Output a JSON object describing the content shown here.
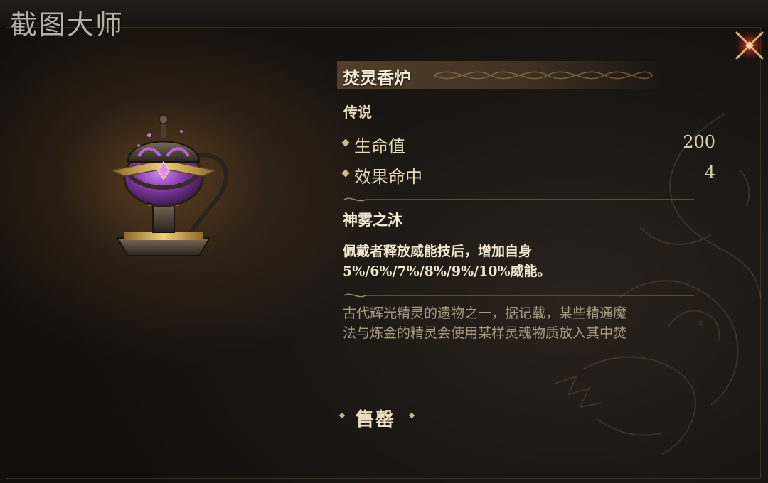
{
  "watermark": "截图大师",
  "item": {
    "name": "焚灵香炉",
    "rarity": "传说"
  },
  "stats": [
    {
      "label": "生命值",
      "value": "200"
    },
    {
      "label": "效果命中",
      "value": "4"
    }
  ],
  "skill": {
    "name": "神雾之沐",
    "description_lines": [
      "佩戴者释放威能技后，增加自身",
      "5%/6%/7%/8%/9%/10%威能。"
    ]
  },
  "lore_lines": [
    "古代辉光精灵的遗物之一，据记载，某些精通魔",
    "法与炼金的精灵会使用某样灵魂物质放入其中焚"
  ],
  "actions": {
    "sell_label": "售罄"
  },
  "icons": {
    "close": "close-x-icon",
    "item": "incense-burner-icon",
    "stat_bullet": "diamond-bullet-icon"
  },
  "colors": {
    "accent_gold": "#c9a25c",
    "close_red": "#c0392b",
    "item_purple": "#a64fd0"
  }
}
